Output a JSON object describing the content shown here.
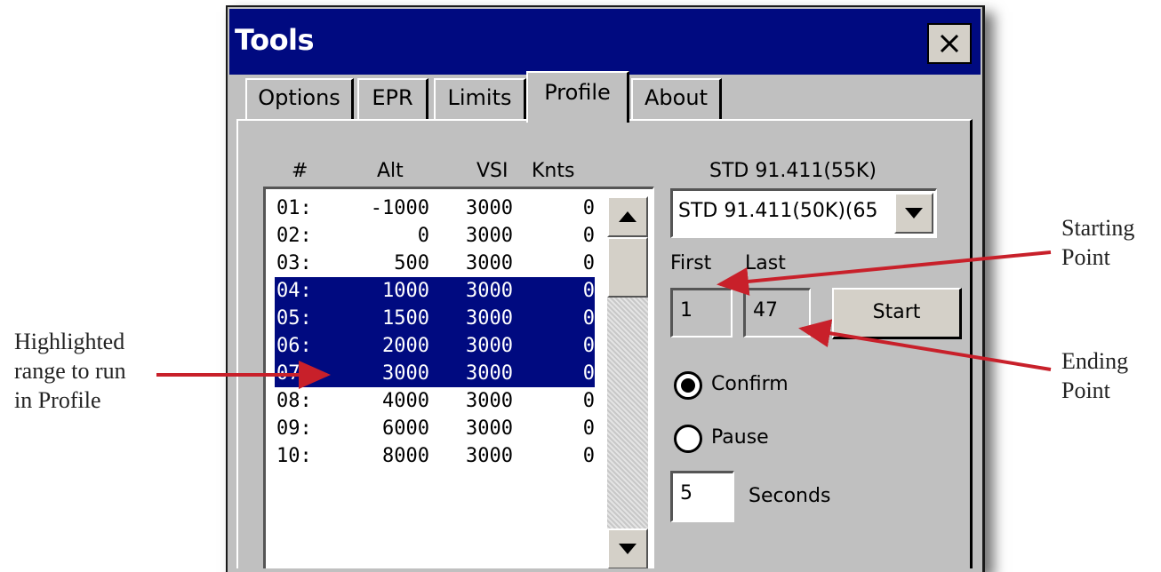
{
  "window": {
    "title": "Tools"
  },
  "tabs": [
    {
      "label": "Options",
      "active": false
    },
    {
      "label": "EPR",
      "active": false
    },
    {
      "label": "Limits",
      "active": false
    },
    {
      "label": "Profile",
      "active": true
    },
    {
      "label": "About",
      "active": false
    }
  ],
  "list": {
    "headers": {
      "num": "#",
      "alt": "Alt",
      "vsi": "VSI",
      "knts": "Knts"
    },
    "rows": [
      {
        "num": "01:",
        "alt": "-1000",
        "vsi": "3000",
        "knts": "0",
        "selected": false
      },
      {
        "num": "02:",
        "alt": "0",
        "vsi": "3000",
        "knts": "0",
        "selected": false
      },
      {
        "num": "03:",
        "alt": "500",
        "vsi": "3000",
        "knts": "0",
        "selected": false
      },
      {
        "num": "04:",
        "alt": "1000",
        "vsi": "3000",
        "knts": "0",
        "selected": true
      },
      {
        "num": "05:",
        "alt": "1500",
        "vsi": "3000",
        "knts": "0",
        "selected": true
      },
      {
        "num": "06:",
        "alt": "2000",
        "vsi": "3000",
        "knts": "0",
        "selected": true
      },
      {
        "num": "07:",
        "alt": "3000",
        "vsi": "3000",
        "knts": "0",
        "selected": true
      },
      {
        "num": "08:",
        "alt": "4000",
        "vsi": "3000",
        "knts": "0",
        "selected": false
      },
      {
        "num": "09:",
        "alt": "6000",
        "vsi": "3000",
        "knts": "0",
        "selected": false
      },
      {
        "num": "10:",
        "alt": "8000",
        "vsi": "3000",
        "knts": "0",
        "selected": false
      }
    ]
  },
  "profile": {
    "current_label": "STD 91.411(55K)",
    "selected_option": "STD 91.411(50K)(65",
    "first_label": "First",
    "last_label": "Last",
    "first_value": "1",
    "last_value": "47",
    "start_label": "Start",
    "confirm_label": "Confirm",
    "pause_label": "Pause",
    "mode": "Confirm",
    "seconds_value": "5",
    "seconds_label": "Seconds"
  },
  "annotations": {
    "highlight": [
      "Highlighted",
      "range to run",
      "in Profile"
    ],
    "starting": [
      "Starting",
      "Point"
    ],
    "ending": [
      "Ending",
      "Point"
    ],
    "arrow_color": "#c8202a"
  },
  "colors": {
    "titlebar": "#000a80",
    "selection": "#000a80",
    "face": "#c0c0c0"
  }
}
